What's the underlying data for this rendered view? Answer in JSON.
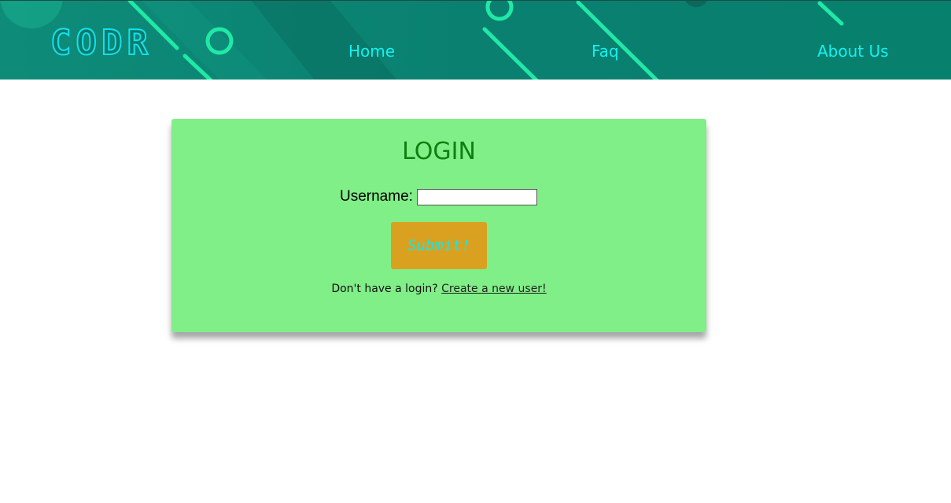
{
  "header": {
    "logo": "CODR",
    "nav": {
      "home": "Home",
      "faq": "Faq",
      "about": "About Us"
    }
  },
  "login": {
    "title": "LOGIN",
    "username_label": "Username:",
    "username_value": "",
    "submit_label": "Submit!",
    "signup_prompt": "Don't have a login?",
    "signup_link": "Create a new user!"
  },
  "colors": {
    "header_bg": "#0a8070",
    "nav_text": "#12f2f0",
    "card_bg": "#80ef87",
    "title": "#0d800f",
    "submit_bg": "#daa121",
    "submit_text": "#17e6e4"
  }
}
